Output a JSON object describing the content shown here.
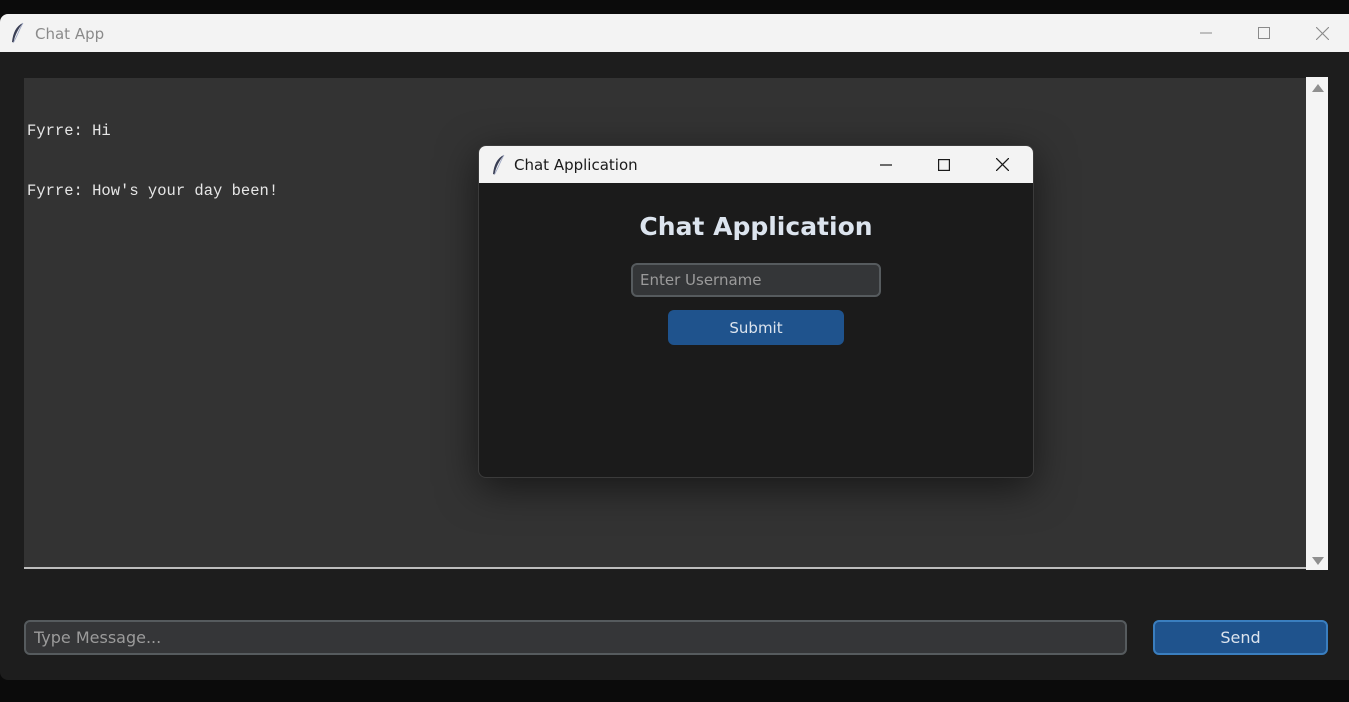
{
  "main_window": {
    "title": "Chat App",
    "icon": "feather-icon",
    "controls": [
      "minimize-icon",
      "maximize-icon",
      "close-icon"
    ]
  },
  "chat": {
    "lines": [
      "Fyrre: Hi",
      "Fyrre: How's your day been!"
    ]
  },
  "message_input": {
    "value": "",
    "placeholder": "Type Message..."
  },
  "send_button": {
    "label": "Send"
  },
  "dialog": {
    "title": "Chat Application",
    "icon": "feather-icon",
    "heading": "Chat Application",
    "username_input": {
      "value": "",
      "placeholder": "Enter Username"
    },
    "submit_label": "Submit"
  },
  "colors": {
    "accent": "#1f538d",
    "accent_border": "#3a7ebf",
    "background": "#1d1d1d",
    "chat_background": "#333333",
    "titlebar": "#f3f3f3"
  }
}
